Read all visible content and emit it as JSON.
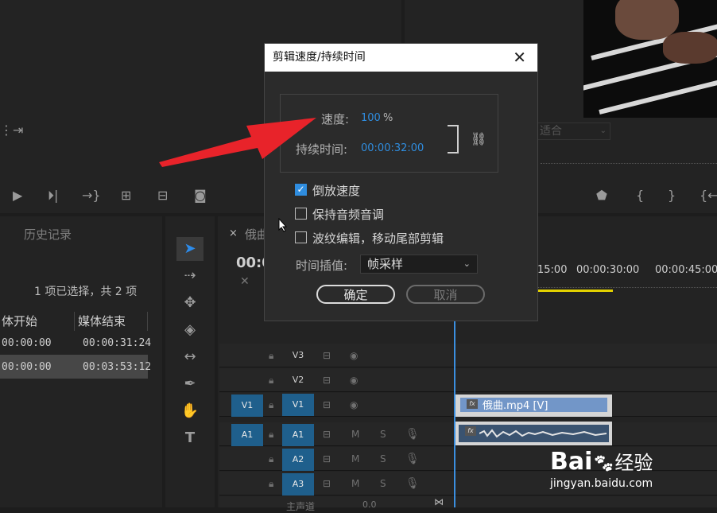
{
  "project_panel": {
    "tab_history": "历史记录",
    "selection_info": "1 项已选择，共 2 项",
    "columns": [
      "体开始",
      "媒体结束"
    ],
    "rows": [
      {
        "start": "00:00:00",
        "end": "00:00:31:24"
      },
      {
        "start": "00:00:00",
        "end": "00:03:53:12"
      }
    ]
  },
  "program_monitor": {
    "fit_label": "适合"
  },
  "timeline": {
    "tab_close": "×",
    "sequence_name": "俄曲",
    "timecode": "00:0",
    "ruler": [
      "15:00",
      "00:00:30:00",
      "00:00:45:00"
    ],
    "video_tracks": [
      "V3",
      "V2",
      "V1"
    ],
    "audio_tracks": [
      "A1",
      "A2",
      "A3"
    ],
    "source_v1": "V1",
    "source_a1": "A1",
    "mute_label": "M",
    "solo_label": "S",
    "master_label": "主声道",
    "master_value": "0.0",
    "clip_video_label": "俄曲.mp4 [V]",
    "fx_label": "fx"
  },
  "dialog": {
    "title": "剪辑速度/持续时间",
    "speed_label": "速度:",
    "speed_value": "100",
    "speed_unit": "%",
    "duration_label": "持续时间:",
    "duration_value": "00:00:32:00",
    "reverse_label": "倒放速度",
    "reverse_checked": true,
    "maintain_pitch_label": "保持音频音调",
    "maintain_pitch_checked": false,
    "ripple_label": "波纹编辑，移动尾部剪辑",
    "ripple_checked": false,
    "interp_label": "时间插值:",
    "interp_value": "帧采样",
    "ok_label": "确定",
    "cancel_label": "取消"
  },
  "watermark": {
    "brand": "Bai",
    "brand_cn": "经验",
    "url": "jingyan.baidu.com"
  },
  "colors": {
    "accent": "#2f8ddf",
    "arrow": "#e8232a",
    "track_blue": "#1f5f8c",
    "clip_video": "#7296c8"
  }
}
